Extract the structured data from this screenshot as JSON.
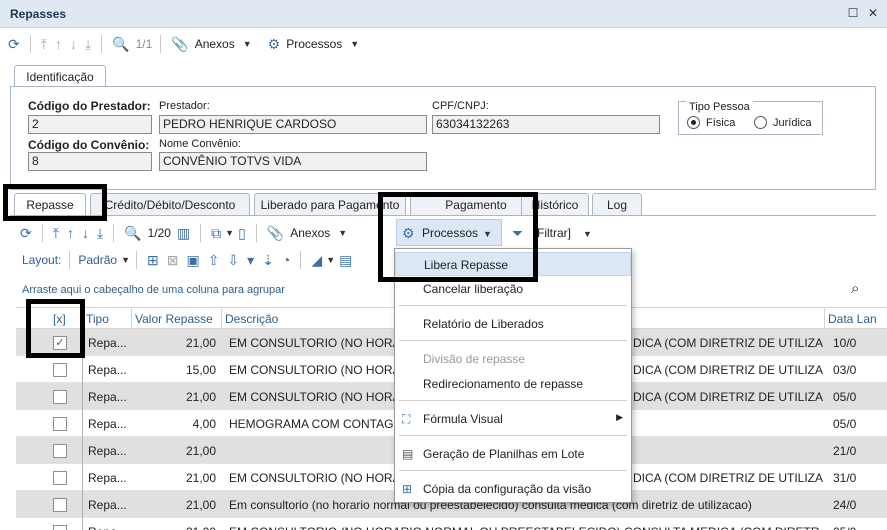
{
  "window": {
    "title": "Repasses",
    "restore_glyph": "☐",
    "close_glyph": "✕"
  },
  "top_toolbar": {
    "pager": "1/1",
    "anexos": "Anexos",
    "processos": "Processos"
  },
  "tabs_top": [
    {
      "label": "Identificação"
    }
  ],
  "identificacao": {
    "codigo_prestador_label": "Código do Prestador:",
    "codigo_prestador_value": "2",
    "prestador_label": "Prestador:",
    "prestador_value": "PEDRO HENRIQUE CARDOSO",
    "cpf_cnpj_label": "CPF/CNPJ:",
    "cpf_cnpj_value": "63034132263",
    "tipo_pessoa_label": "Tipo Pessoa",
    "fisica_label": "Física",
    "juridica_label": "Jurídica",
    "codigo_convenio_label": "Código do Convênio:",
    "codigo_convenio_value": "8",
    "nome_convenio_label": "Nome Convênio:",
    "nome_convenio_value": "CONVÊNIO TOTVS  VIDA"
  },
  "tabs_detail": [
    {
      "label": "Repasse"
    },
    {
      "label": "Crédito/Débito/Desconto"
    },
    {
      "label": "Liberado para Pagamento"
    },
    {
      "label": "Pagamento"
    },
    {
      "label": "Histórico"
    },
    {
      "label": "Log"
    }
  ],
  "detail_toolbar": {
    "pager": "1/20",
    "anexos": "Anexos",
    "processos": "Processos",
    "filtrar": "Filtrar]"
  },
  "layout_bar": {
    "layout_label": "Layout:",
    "layout_value": "Padrão"
  },
  "group_hint": "Arraste aqui o cabeçalho de uma coluna para agrupar",
  "grid": {
    "columns": [
      "[x]",
      "Tipo",
      "Valor Repasse",
      "Descrição",
      "Data Lan"
    ],
    "rows": [
      {
        "checked": true,
        "tipo": "Repa...",
        "valor": "21,00",
        "descricao": "EM CONSULTORIO (NO HORARIO",
        "descricao_right": "DICA (COM DIRETRIZ DE UTILIZACAO)",
        "data": "10/0"
      },
      {
        "checked": false,
        "tipo": "Repa...",
        "valor": "15,00",
        "descricao": "EM CONSULTORIO (NO HORARIO",
        "descricao_right": "DICA (COM DIRETRIZ DE UTILIZACAO)",
        "data": "03/0"
      },
      {
        "checked": false,
        "tipo": "Repa...",
        "valor": "21,00",
        "descricao": "EM CONSULTORIO (NO HORARIO",
        "descricao_right": "DICA (COM DIRETRIZ DE UTILIZACAO)",
        "data": "05/0"
      },
      {
        "checked": false,
        "tipo": "Repa...",
        "valor": "4,00",
        "descricao": "HEMOGRAMA COM CONTAGEM DE",
        "descricao_right": "",
        "data": "05/0"
      },
      {
        "checked": false,
        "tipo": "Repa...",
        "valor": "21,00",
        "descricao": "",
        "descricao_right": "",
        "data": "21/0"
      },
      {
        "checked": false,
        "tipo": "Repa...",
        "valor": "21,00",
        "descricao": "EM CONSULTORIO (NO HORARIO",
        "descricao_right": "DICA (COM DIRETRIZ DE UTILIZACAO)",
        "data": "31/0"
      },
      {
        "checked": false,
        "tipo": "Repa...",
        "valor": "21,00",
        "descricao": "Em consultorio (no horario normal ou preestabelecido) consulta medica (com diretriz de utilizacao)",
        "descricao_right": "",
        "data": "24/0"
      },
      {
        "checked": false,
        "tipo": "Repa...",
        "valor": "21,00",
        "descricao": "EM CONSULTORIO (NO HORARIO NORMAL OU PREESTABELECIDO) CONSULTA MEDICA (COM DIRETRIZ DE UTILIZACAO)",
        "descricao_right": "",
        "data": "05/0"
      }
    ]
  },
  "processos_menu": {
    "items": [
      {
        "label": "Libera Repasse"
      },
      {
        "label": "Cancelar liberação"
      },
      {
        "label": "Relatório de Liberados"
      },
      {
        "label": "Divisão de repasse"
      },
      {
        "label": "Redirecionamento de repasse"
      },
      {
        "label": "Fórmula Visual"
      },
      {
        "label": "Geração de Planilhas em Lote"
      },
      {
        "label": "Cópia da configuração da visão"
      }
    ]
  }
}
